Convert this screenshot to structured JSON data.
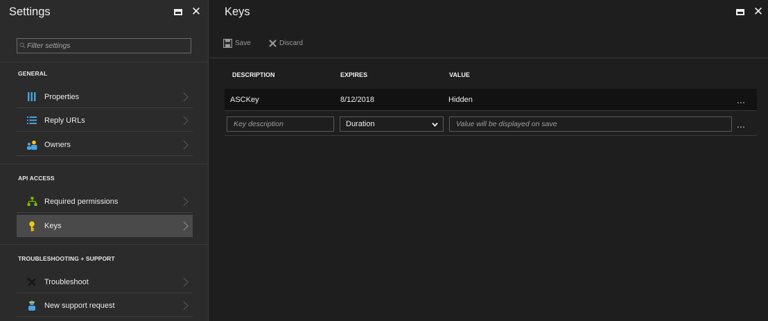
{
  "settings": {
    "title": "Settings",
    "filter": {
      "placeholder": "Filter settings",
      "value": ""
    },
    "sections": [
      {
        "label": "GENERAL",
        "items": [
          {
            "label": "Properties",
            "icon": "properties-icon"
          },
          {
            "label": "Reply URLs",
            "icon": "list-icon"
          },
          {
            "label": "Owners",
            "icon": "people-icon"
          }
        ]
      },
      {
        "label": "API ACCESS",
        "items": [
          {
            "label": "Required permissions",
            "icon": "hierarchy-icon"
          },
          {
            "label": "Keys",
            "icon": "key-icon",
            "selected": true
          }
        ]
      },
      {
        "label": "TROUBLESHOOTING + SUPPORT",
        "items": [
          {
            "label": "Troubleshoot",
            "icon": "tools-icon"
          },
          {
            "label": "New support request",
            "icon": "support-person-icon"
          }
        ]
      }
    ]
  },
  "keys": {
    "title": "Keys",
    "toolbar": {
      "save_label": "Save",
      "discard_label": "Discard"
    },
    "columns": {
      "description": "DESCRIPTION",
      "expires": "EXPIRES",
      "value": "VALUE"
    },
    "rows": [
      {
        "description": "ASCKey",
        "expires": "8/12/2018",
        "value": "Hidden",
        "more": "..."
      }
    ],
    "new_row": {
      "description_placeholder": "Key description",
      "duration_selected": "Duration",
      "value_placeholder": "Value will be displayed on save",
      "more": "..."
    }
  },
  "colors": {
    "sidebar_bg": "#2b2b2b",
    "content_bg": "#1e1e1e",
    "selected_item_bg": "#4a4a4a",
    "icon_blue": "#4aa3df",
    "icon_green": "#7fba00",
    "icon_yellow": "#f2c811"
  }
}
